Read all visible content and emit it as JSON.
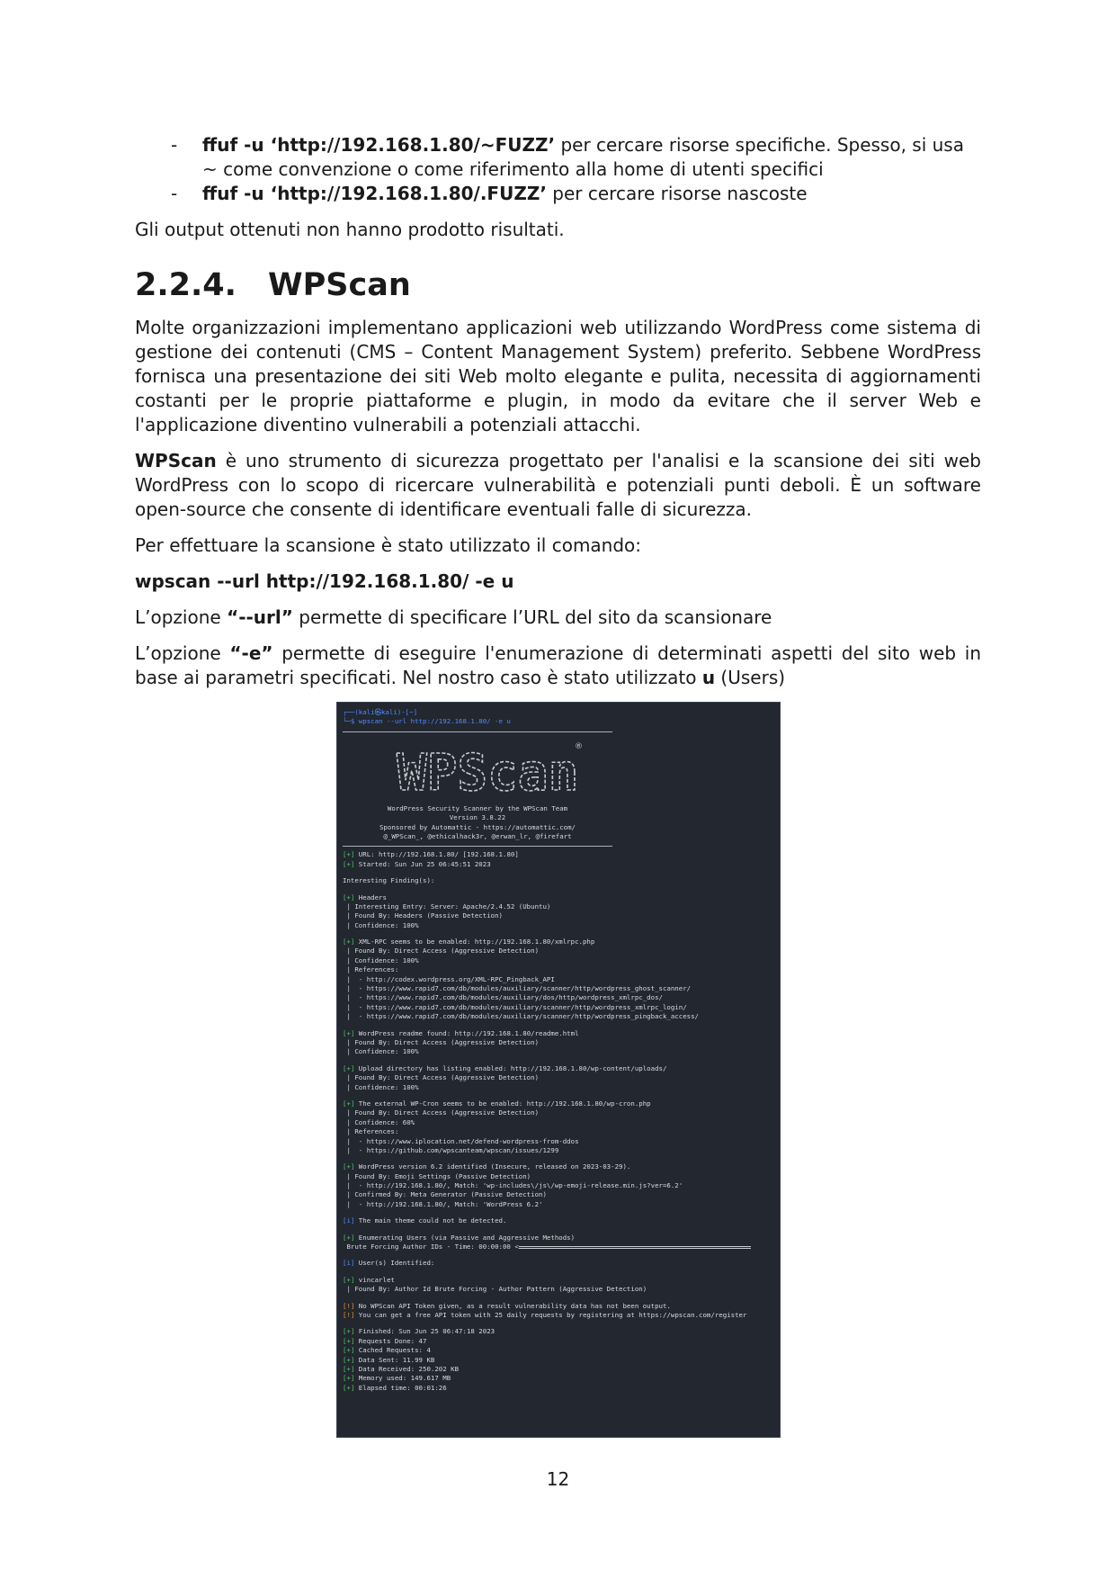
{
  "bullets": [
    {
      "dash": "-",
      "cmd": "ffuf -u ‘http://192.168.1.80/~FUZZ’",
      "rest": " per cercare risorse specifiche. Spesso, si usa ~ come convenzione o come riferimento alla home di utenti specifici"
    },
    {
      "dash": "-",
      "cmd": "ffuf -u ‘http://192.168.1.80/.FUZZ’",
      "rest": " per cercare risorse nascoste"
    }
  ],
  "p_output": "Gli output ottenuti non hanno prodotto risultati.",
  "section": {
    "number": "2.2.4.",
    "title": "WPScan"
  },
  "p_intro": "Molte organizzazioni implementano applicazioni web utilizzando WordPress come sistema di gestione dei contenuti (CMS – Content Management System) preferito. Sebbene WordPress fornisca una presentazione dei siti Web molto elegante e pulita, necessita di aggiornamenti costanti per le proprie piattaforme e plugin, in modo da evitare che il server Web e l'applicazione diventino vulnerabili a potenziali attacchi.",
  "p_wpscan": {
    "bold": "WPScan",
    "rest": " è uno strumento di sicurezza progettato per l'analisi e la scansione dei siti web WordPress con lo scopo di ricercare vulnerabilità e potenziali punti deboli. È un software open-source che consente di identificare eventuali falle di sicurezza."
  },
  "p_scan": "Per effettuare la scansione è stato utilizzato il comando:",
  "command": "wpscan --url http://192.168.1.80/ -e u",
  "p_url": {
    "pre": "L’opzione ",
    "bold": "“--url”",
    "post": " permette di specificare l’URL del sito da scansionare"
  },
  "p_e": {
    "pre": "L’opzione ",
    "bold": "“-e”",
    "mid": " permette di eseguire l'enumerazione di determinati aspetti del sito web in base ai parametri specificati. Nel nostro caso è stato utilizzato ",
    "bold2": "u",
    "post": " (Users)"
  },
  "terminal": {
    "prompt1": "┌──(kali㉿kali)-[~]",
    "prompt2": "└─$ wpscan --url http://192.168.1.80/ -e u",
    "logo_text": "WPScan",
    "banner": [
      "WordPress Security Scanner by the WPScan Team",
      "Version 3.8.22",
      "Sponsored by Automattic - https://automattic.com/",
      "@_WPScan_, @ethicalhack3r, @erwan_lr, @firefart"
    ],
    "lines": [
      {
        "t": "plus",
        "s": "[+] URL: http://192.168.1.80/ [192.168.1.80]"
      },
      {
        "t": "plus",
        "s": "[+] Started: Sun Jun 25 06:45:51 2023"
      },
      {
        "t": "gap"
      },
      {
        "t": "text",
        "s": "Interesting Finding(s):"
      },
      {
        "t": "gap"
      },
      {
        "t": "plus",
        "s": "[+] Headers"
      },
      {
        "t": "text",
        "s": " | Interesting Entry: Server: Apache/2.4.52 (Ubuntu)"
      },
      {
        "t": "text",
        "s": " | Found By: Headers (Passive Detection)"
      },
      {
        "t": "text",
        "s": " | Confidence: 100%"
      },
      {
        "t": "gap"
      },
      {
        "t": "plus",
        "s": "[+] XML-RPC seems to be enabled: http://192.168.1.80/xmlrpc.php"
      },
      {
        "t": "text",
        "s": " | Found By: Direct Access (Aggressive Detection)"
      },
      {
        "t": "text",
        "s": " | Confidence: 100%"
      },
      {
        "t": "text",
        "s": " | References:"
      },
      {
        "t": "text",
        "s": " |  - http://codex.wordpress.org/XML-RPC_Pingback_API"
      },
      {
        "t": "text",
        "s": " |  - https://www.rapid7.com/db/modules/auxiliary/scanner/http/wordpress_ghost_scanner/"
      },
      {
        "t": "text",
        "s": " |  - https://www.rapid7.com/db/modules/auxiliary/dos/http/wordpress_xmlrpc_dos/"
      },
      {
        "t": "text",
        "s": " |  - https://www.rapid7.com/db/modules/auxiliary/scanner/http/wordpress_xmlrpc_login/"
      },
      {
        "t": "text",
        "s": " |  - https://www.rapid7.com/db/modules/auxiliary/scanner/http/wordpress_pingback_access/"
      },
      {
        "t": "gap"
      },
      {
        "t": "plus",
        "s": "[+] WordPress readme found: http://192.168.1.80/readme.html"
      },
      {
        "t": "text",
        "s": " | Found By: Direct Access (Aggressive Detection)"
      },
      {
        "t": "text",
        "s": " | Confidence: 100%"
      },
      {
        "t": "gap"
      },
      {
        "t": "plus",
        "s": "[+] Upload directory has listing enabled: http://192.168.1.80/wp-content/uploads/"
      },
      {
        "t": "text",
        "s": " | Found By: Direct Access (Aggressive Detection)"
      },
      {
        "t": "text",
        "s": " | Confidence: 100%"
      },
      {
        "t": "gap"
      },
      {
        "t": "plus",
        "s": "[+] The external WP-Cron seems to be enabled: http://192.168.1.80/wp-cron.php"
      },
      {
        "t": "text",
        "s": " | Found By: Direct Access (Aggressive Detection)"
      },
      {
        "t": "text",
        "s": " | Confidence: 60%"
      },
      {
        "t": "text",
        "s": " | References:"
      },
      {
        "t": "text",
        "s": " |  - https://www.iplocation.net/defend-wordpress-from-ddos"
      },
      {
        "t": "text",
        "s": " |  - https://github.com/wpscanteam/wpscan/issues/1299"
      },
      {
        "t": "gap"
      },
      {
        "t": "plus",
        "s": "[+] WordPress version 6.2 identified (Insecure, released on 2023-03-29)."
      },
      {
        "t": "text",
        "s": " | Found By: Emoji Settings (Passive Detection)"
      },
      {
        "t": "text",
        "s": " |  - http://192.168.1.80/, Match: 'wp-includes\\/js\\/wp-emoji-release.min.js?ver=6.2'"
      },
      {
        "t": "text",
        "s": " | Confirmed By: Meta Generator (Passive Detection)"
      },
      {
        "t": "text",
        "s": " |  - http://192.168.1.80/, Match: 'WordPress 6.2'"
      },
      {
        "t": "gap"
      },
      {
        "t": "info",
        "s": "[i] The main theme could not be detected."
      },
      {
        "t": "gap"
      },
      {
        "t": "plus",
        "s": "[+] Enumerating Users (via Passive and Aggressive Methods)"
      },
      {
        "t": "bar",
        "s": " Brute Forcing Author IDs - Time: 00:00:00 <"
      },
      {
        "t": "gap"
      },
      {
        "t": "info",
        "s": "[i] User(s) Identified:"
      },
      {
        "t": "gap"
      },
      {
        "t": "plus",
        "s": "[+] vincarlet"
      },
      {
        "t": "text",
        "s": " | Found By: Author Id Brute Forcing - Author Pattern (Aggressive Detection)"
      },
      {
        "t": "gap"
      },
      {
        "t": "warn",
        "s": "[!] No WPScan API Token given, as a result vulnerability data has not been output."
      },
      {
        "t": "warn",
        "s": "[!] You can get a free API token with 25 daily requests by registering at https://wpscan.com/register"
      },
      {
        "t": "gap"
      },
      {
        "t": "plus",
        "s": "[+] Finished: Sun Jun 25 06:47:18 2023"
      },
      {
        "t": "plus",
        "s": "[+] Requests Done: 47"
      },
      {
        "t": "plus",
        "s": "[+] Cached Requests: 4"
      },
      {
        "t": "plus",
        "s": "[+] Data Sent: 11.99 KB"
      },
      {
        "t": "plus",
        "s": "[+] Data Received: 250.202 KB"
      },
      {
        "t": "plus",
        "s": "[+] Memory used: 149.617 MB"
      },
      {
        "t": "plus",
        "s": "[+] Elapsed time: 00:01:26"
      }
    ]
  },
  "page_number": "12"
}
